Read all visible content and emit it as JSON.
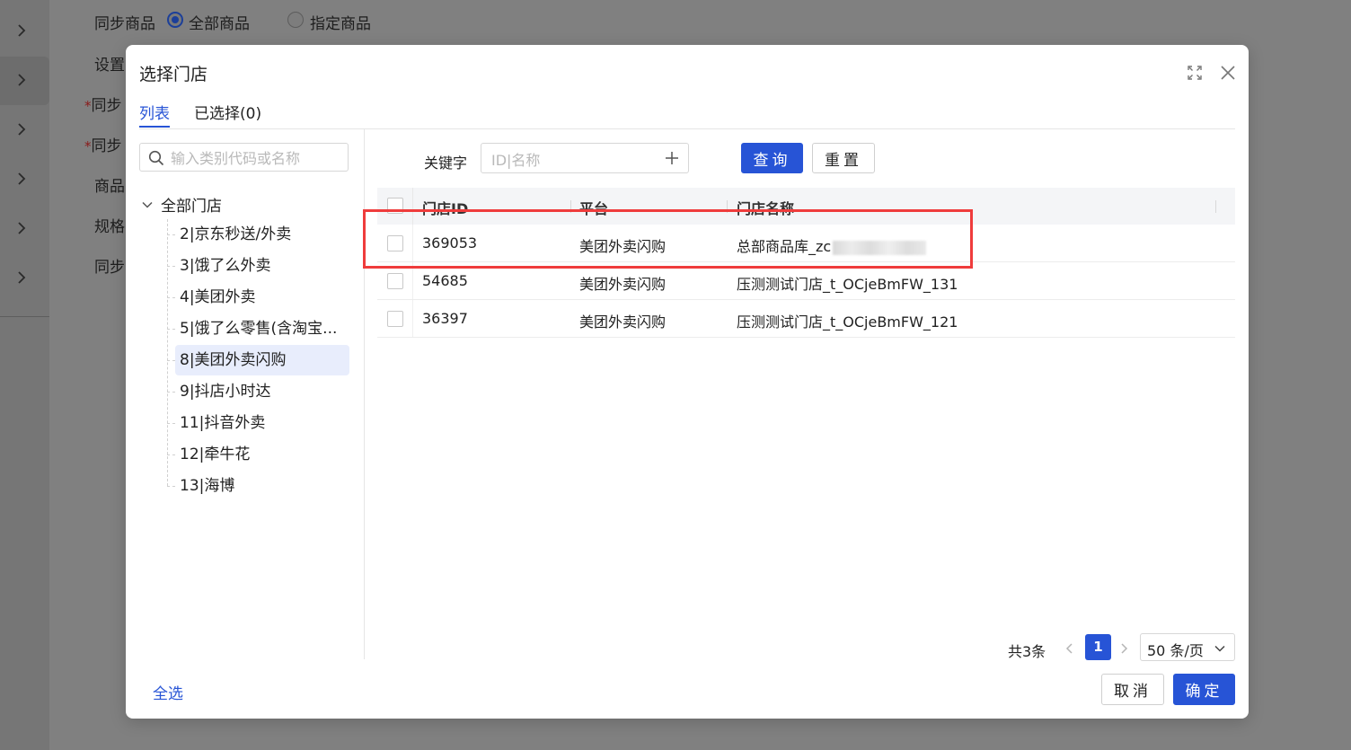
{
  "background": {
    "rows": [
      {
        "label": "同步商品",
        "required": false
      },
      {
        "label": "设置",
        "required": false
      },
      {
        "label": "同步",
        "required": true
      },
      {
        "label": "同步",
        "required": true
      },
      {
        "label": "商品",
        "required": false
      },
      {
        "label": "规格",
        "required": false
      },
      {
        "label": "同步",
        "required": false
      }
    ],
    "radio_all": "全部商品",
    "radio_specified": "指定商品",
    "required_mark": "*"
  },
  "modal": {
    "title": "选择门店",
    "tabs": [
      {
        "label": "列表",
        "active": true
      },
      {
        "label": "已选择(0)",
        "active": false
      }
    ],
    "tree": {
      "search_placeholder": "输入类别代码或名称",
      "root_label": "全部门店",
      "items": [
        {
          "label": "2|京东秒送/外卖"
        },
        {
          "label": "3|饿了么外卖"
        },
        {
          "label": "4|美团外卖"
        },
        {
          "label": "5|饿了么零售(含淘宝..."
        },
        {
          "label": "8|美团外卖闪购",
          "selected": true
        },
        {
          "label": "9|抖店小时达"
        },
        {
          "label": "11|抖音外卖"
        },
        {
          "label": "12|牵牛花"
        },
        {
          "label": "13|海博"
        }
      ]
    },
    "filter": {
      "keyword_label": "关键字",
      "keyword_placeholder": "ID|名称",
      "query_label": "查询",
      "reset_label": "重置"
    },
    "table": {
      "columns": [
        "门店ID",
        "平台",
        "门店名称"
      ],
      "rows": [
        {
          "id": "369053",
          "platform": "美团外卖闪购",
          "name": "总部商品库_zc"
        },
        {
          "id": "54685",
          "platform": "美团外卖闪购",
          "name": "压测测试门店_t_OCjeBmFW_131"
        },
        {
          "id": "36397",
          "platform": "美团外卖闪购",
          "name": "压测测试门店_t_OCjeBmFW_121"
        }
      ]
    },
    "pagination": {
      "total": "共3条",
      "current_page": "1",
      "page_size": "50 条/页"
    },
    "footer": {
      "select_all": "全选",
      "cancel_label": "取消",
      "confirm_label": "确定"
    },
    "accent_color": "#2754d6",
    "highlight_color": "#ef3c3c"
  }
}
